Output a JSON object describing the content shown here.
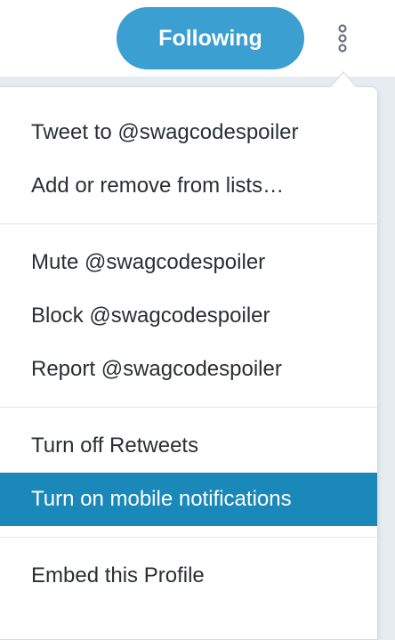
{
  "header": {
    "follow_button_label": "Following",
    "more_icon": "vertical-ellipsis-icon"
  },
  "menu": {
    "items": [
      {
        "label": "Tweet to @swagcodespoiler"
      },
      {
        "label": "Add or remove from lists…"
      },
      {
        "label": "Mute @swagcodespoiler"
      },
      {
        "label": "Block @swagcodespoiler"
      },
      {
        "label": "Report @swagcodespoiler"
      },
      {
        "label": "Turn off Retweets"
      },
      {
        "label": "Turn on mobile notifications",
        "highlighted": true
      },
      {
        "label": "Embed this Profile"
      }
    ]
  },
  "colors": {
    "accent": "#3b9fd1",
    "highlight": "#1a88b8",
    "text": "#292f33",
    "background": "#e6ecf0"
  }
}
